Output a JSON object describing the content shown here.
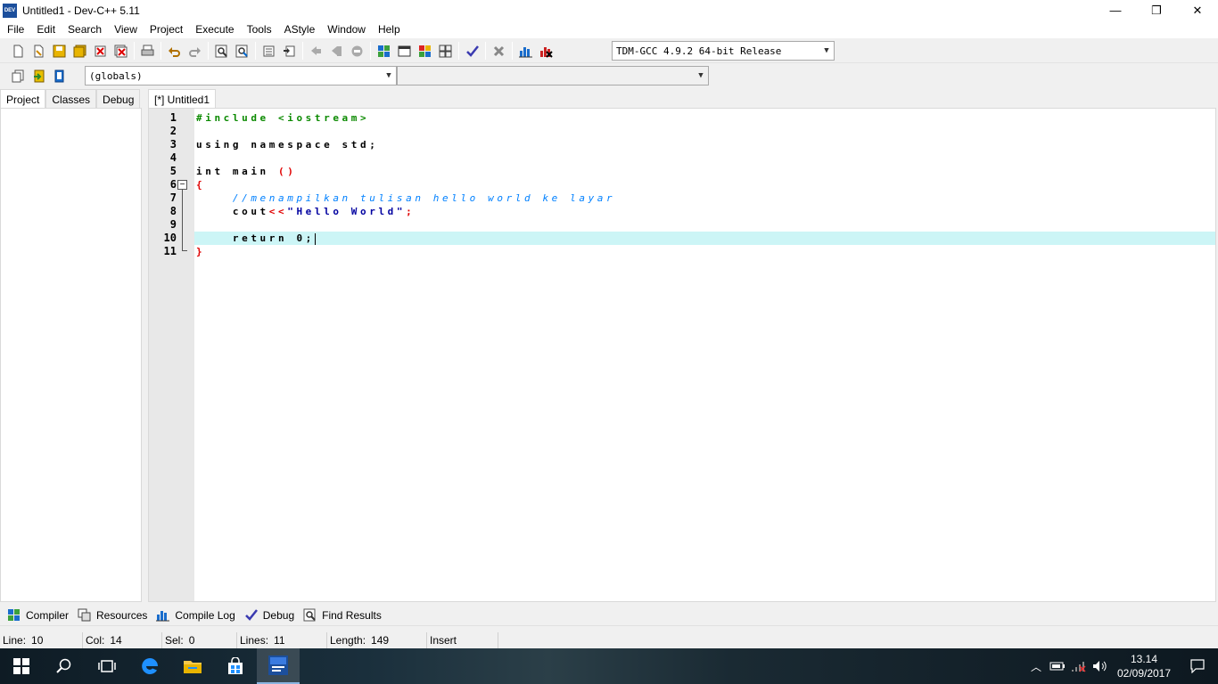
{
  "window": {
    "title": "Untitled1 - Dev-C++ 5.11",
    "app_icon_text": "DEV",
    "minimize": "—",
    "restore": "❐",
    "close": "✕"
  },
  "menu": [
    "File",
    "Edit",
    "Search",
    "View",
    "Project",
    "Execute",
    "Tools",
    "AStyle",
    "Window",
    "Help"
  ],
  "toolbar": {
    "compiler_select": "TDM-GCC 4.9.2 64-bit Release",
    "scope_select": "(globals)",
    "member_select": ""
  },
  "left_tabs": [
    "Project",
    "Classes",
    "Debug"
  ],
  "editor": {
    "tab_label": "[*] Untitled1",
    "line_numbers": [
      "1",
      "2",
      "3",
      "4",
      "5",
      "6",
      "7",
      "8",
      "9",
      "10",
      "11"
    ],
    "lines": {
      "l1": "#include <iostream>",
      "l3": "using namespace std;",
      "l5_kw": "int main ",
      "l5_sym": "()",
      "l6": "{",
      "l7": "    //menampilkan tulisan hello world ke layar",
      "l8_kw": "    cout",
      "l8_sym": "<<",
      "l8_str": "\"Hello World\"",
      "l8_end": ";",
      "l10": "    return 0;",
      "l11": "}"
    },
    "fold_box": "−"
  },
  "bottom_tabs": [
    "Compiler",
    "Resources",
    "Compile Log",
    "Debug",
    "Find Results"
  ],
  "status": {
    "line_label": "Line:",
    "line_value": "10",
    "col_label": "Col:",
    "col_value": "14",
    "sel_label": "Sel:",
    "sel_value": "0",
    "lines_label": "Lines:",
    "lines_value": "11",
    "length_label": "Length:",
    "length_value": "149",
    "mode": "Insert"
  },
  "taskbar": {
    "time": "13.14",
    "date": "02/09/2017"
  }
}
